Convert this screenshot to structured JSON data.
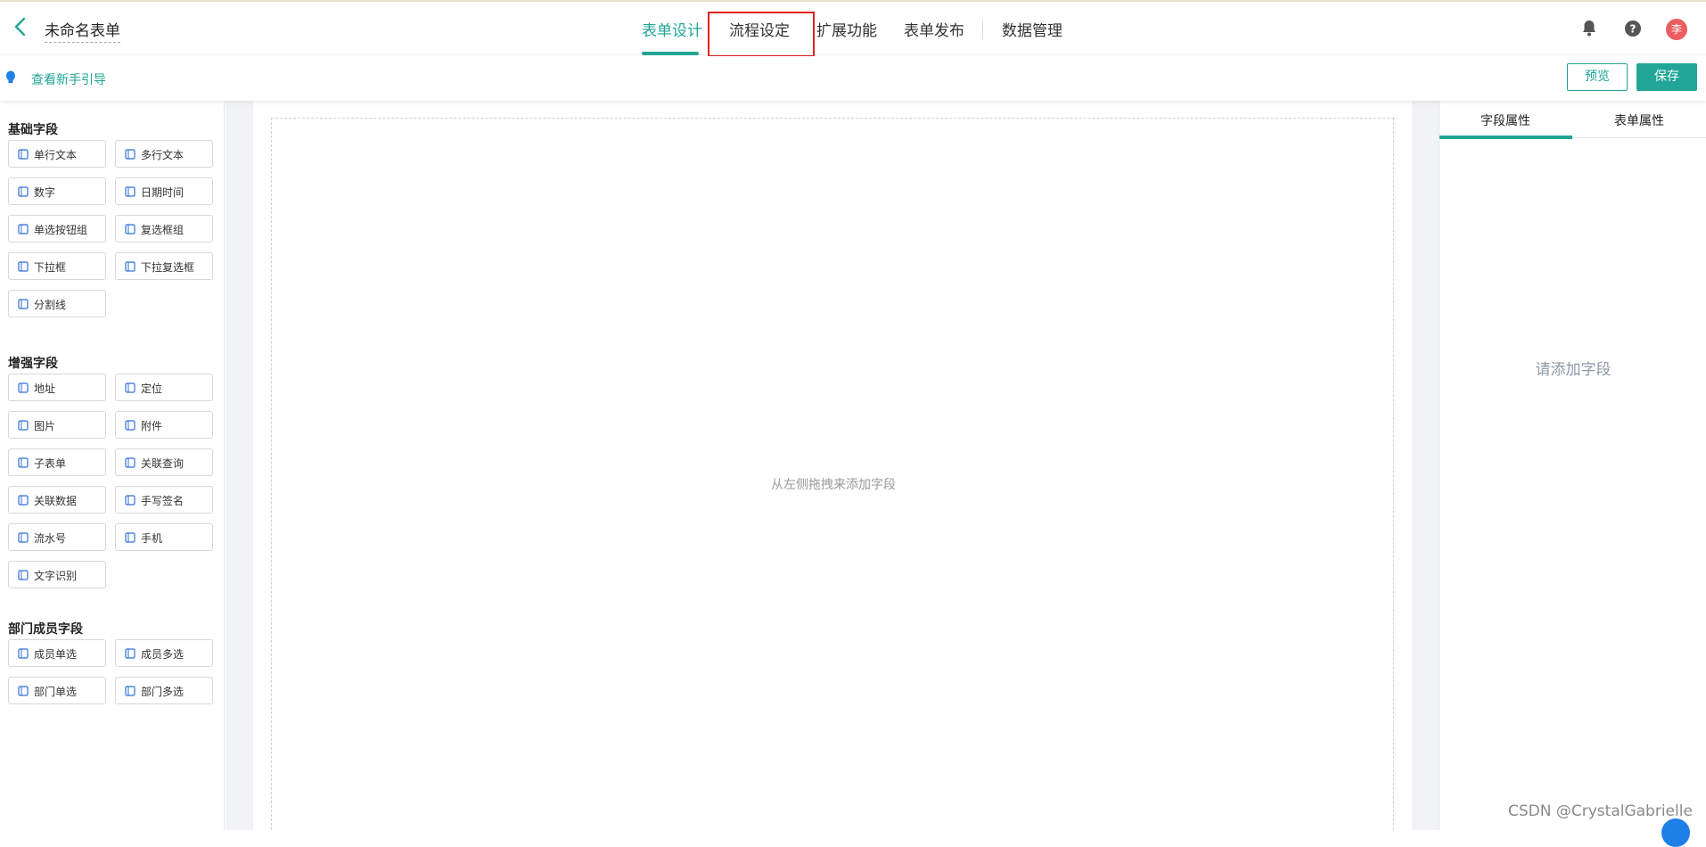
{
  "header": {
    "form_title": "未命名表单",
    "tabs": [
      {
        "label": "表单设计",
        "active": true
      },
      {
        "label": "流程设定",
        "highlighted": true
      },
      {
        "label": "扩展功能"
      },
      {
        "label": "表单发布"
      },
      {
        "label": "数据管理"
      }
    ],
    "avatar_text": "李"
  },
  "guide": {
    "link_label": "查看新手引导",
    "preview_label": "预览",
    "save_label": "保存"
  },
  "left_panel": {
    "sections": [
      {
        "title": "基础字段",
        "fields": [
          {
            "label": "单行文本",
            "icon": "text-line-icon"
          },
          {
            "label": "多行文本",
            "icon": "text-multi-icon"
          },
          {
            "label": "数字",
            "icon": "number-icon"
          },
          {
            "label": "日期时间",
            "icon": "calendar-icon"
          },
          {
            "label": "单选按钮组",
            "icon": "radio-icon"
          },
          {
            "label": "复选框组",
            "icon": "checkbox-icon"
          },
          {
            "label": "下拉框",
            "icon": "dropdown-icon"
          },
          {
            "label": "下拉复选框",
            "icon": "dropdown-multi-icon"
          },
          {
            "label": "分割线",
            "icon": "divider-icon"
          }
        ]
      },
      {
        "title": "增强字段",
        "fields": [
          {
            "label": "地址",
            "icon": "location-pin-icon"
          },
          {
            "label": "定位",
            "icon": "crosshair-icon"
          },
          {
            "label": "图片",
            "icon": "image-icon"
          },
          {
            "label": "附件",
            "icon": "cloud-upload-icon"
          },
          {
            "label": "子表单",
            "icon": "subform-icon"
          },
          {
            "label": "关联查询",
            "icon": "link-query-icon"
          },
          {
            "label": "关联数据",
            "icon": "link-data-icon"
          },
          {
            "label": "手写签名",
            "icon": "pen-icon"
          },
          {
            "label": "流水号",
            "icon": "serial-number-icon"
          },
          {
            "label": "手机",
            "icon": "mobile-icon"
          },
          {
            "label": "文字识别",
            "icon": "ocr-icon"
          }
        ]
      },
      {
        "title": "部门成员字段",
        "fields": [
          {
            "label": "成员单选",
            "icon": "user-icon"
          },
          {
            "label": "成员多选",
            "icon": "users-icon"
          },
          {
            "label": "部门单选",
            "icon": "department-icon"
          },
          {
            "label": "部门多选",
            "icon": "departments-icon"
          }
        ]
      }
    ]
  },
  "canvas": {
    "drop_hint": "从左侧拖拽来添加字段"
  },
  "right_panel": {
    "tabs": [
      "字段属性",
      "表单属性"
    ],
    "empty_hint": "请添加字段"
  },
  "watermark": "CSDN @CrystalGabrielle",
  "colors": {
    "accent": "#21a597",
    "highlight_box": "#e0211d",
    "avatar": "#ec5d5f",
    "field_icon": "#2f6fd8"
  }
}
